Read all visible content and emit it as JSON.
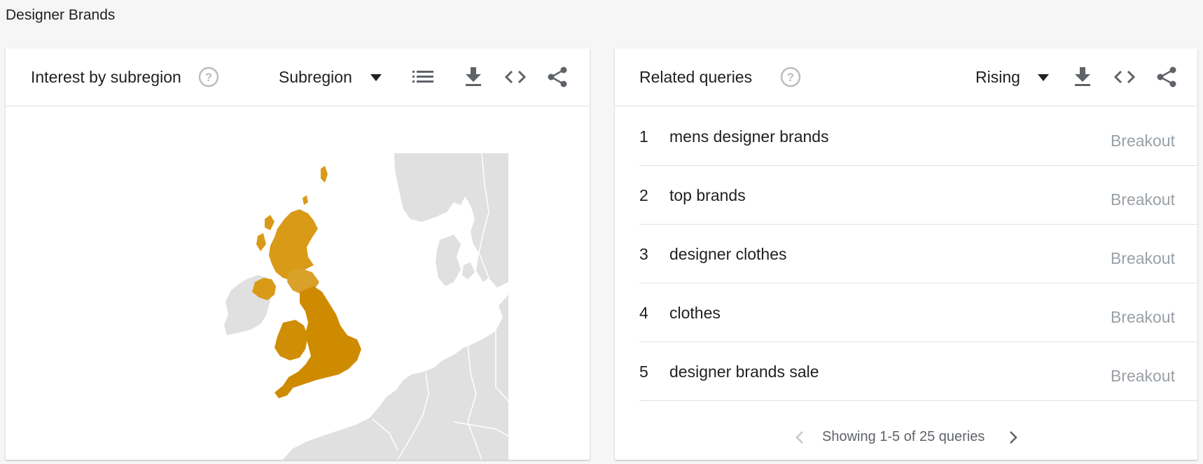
{
  "page": {
    "title": "Designer Brands"
  },
  "left_card": {
    "title": "Interest by subregion",
    "dropdown_label": "Subregion",
    "highlight_color": "#d4930c",
    "map_base_color": "#e0e0e0",
    "tools": [
      "list-icon",
      "download-icon",
      "embed-icon",
      "share-icon"
    ]
  },
  "right_card": {
    "title": "Related queries",
    "dropdown_label": "Rising",
    "tools": [
      "download-icon",
      "embed-icon",
      "share-icon"
    ],
    "queries": [
      {
        "rank": "1",
        "text": "mens designer brands",
        "value": "Breakout"
      },
      {
        "rank": "2",
        "text": "top brands",
        "value": "Breakout"
      },
      {
        "rank": "3",
        "text": "designer clothes",
        "value": "Breakout"
      },
      {
        "rank": "4",
        "text": "clothes",
        "value": "Breakout"
      },
      {
        "rank": "5",
        "text": "designer brands sale",
        "value": "Breakout"
      }
    ],
    "pager_text": "Showing 1-5 of 25 queries"
  }
}
